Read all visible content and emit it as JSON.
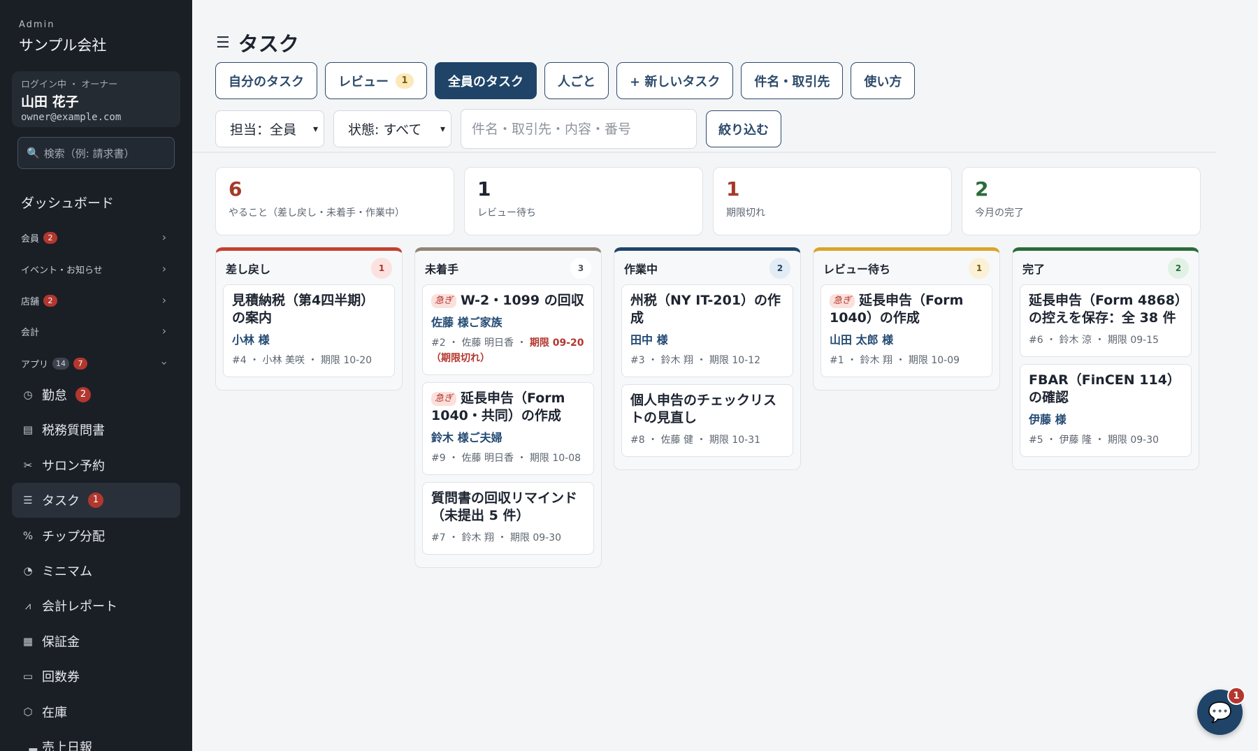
{
  "sidebar": {
    "admin_label": "Admin",
    "company": "サンプル会社",
    "user": {
      "role": "ログイン中 ・ オーナー",
      "name": "山田 花子",
      "email": "owner@example.com"
    },
    "search_placeholder": "検索（例: 請求書）",
    "dashboard": "ダッシュボード",
    "groups": [
      {
        "label": "会員",
        "badge": "2"
      },
      {
        "label": "イベント・お知らせ",
        "badge": ""
      },
      {
        "label": "店舗",
        "badge": "2"
      },
      {
        "label": "会計",
        "badge": ""
      },
      {
        "label": "アプリ",
        "badge_gray": "14",
        "badge": "7"
      }
    ],
    "nav": [
      {
        "label": "勤怠",
        "icon": "clock-icon",
        "badge": "2"
      },
      {
        "label": "税務質問書",
        "icon": "document-icon",
        "badge": ""
      },
      {
        "label": "サロン予約",
        "icon": "scissors-icon",
        "badge": ""
      },
      {
        "label": "タスク",
        "icon": "checklist-icon",
        "badge": "1"
      },
      {
        "label": "チップ分配",
        "icon": "percent-icon",
        "badge": ""
      },
      {
        "label": "ミニマム",
        "icon": "gauge-icon",
        "badge": ""
      },
      {
        "label": "会計レポート",
        "icon": "chart-icon",
        "badge": ""
      },
      {
        "label": "保証金",
        "icon": "receipt-icon",
        "badge": ""
      },
      {
        "label": "回数券",
        "icon": "ticket-icon",
        "badge": ""
      },
      {
        "label": "在庫",
        "icon": "box-icon",
        "badge": ""
      },
      {
        "label": "売上日報",
        "icon": "bar-chart-icon",
        "badge": ""
      }
    ]
  },
  "header": {
    "title": "タスク",
    "icon": "checklist-icon"
  },
  "tabs": [
    {
      "label": "自分のタスク"
    },
    {
      "label": "レビュー",
      "badge": "1"
    },
    {
      "label": "全員のタスク",
      "active": true
    },
    {
      "label": "人ごと"
    },
    {
      "label": "+ 新しいタスク"
    },
    {
      "label": "件名・取引先"
    },
    {
      "label": "使い方"
    }
  ],
  "filters": {
    "assignee": "担当：全員",
    "status": "状態: すべて",
    "search_placeholder": "件名・取引先・内容・番号",
    "submit": "絞り込む"
  },
  "stats": [
    {
      "value": "6",
      "label": "やること（差し戻し・未着手・作業中）",
      "color": "#a53a2a"
    },
    {
      "value": "1",
      "label": "レビュー待ち",
      "color": "#1d2430"
    },
    {
      "value": "1",
      "label": "期限切れ",
      "color": "#a53a2a"
    },
    {
      "value": "2",
      "label": "今月の完了",
      "color": "#2a6b3a"
    }
  ],
  "columns": [
    {
      "title": "差し戻し",
      "count": "1",
      "color": "#c4402f",
      "count_bg": "#fbe2df",
      "count_color": "#a53a2a",
      "cards": [
        {
          "urgent": "",
          "title": "見積納税（第4四半期）の案内",
          "client": "小林 様",
          "meta": "#4 ・ 小林 美咲 ・ 期限 10-20"
        }
      ]
    },
    {
      "title": "未着手",
      "count": "3",
      "color": "#8f8576",
      "count_bg": "#ffffff",
      "count_color": "#4a5260",
      "cards": [
        {
          "urgent": "急ぎ",
          "title": "W-2・1099 の回収",
          "client": "佐藤 様ご家族",
          "meta": "#2 ・ 佐藤 明日香 ・ ",
          "due": "期限 09-20（期限切れ）"
        },
        {
          "urgent": "急ぎ",
          "title": "延長申告（Form 1040・共同）の作成",
          "client": "鈴木 様ご夫婦",
          "meta": "#9 ・ 佐藤 明日香 ・ 期限 10-08"
        },
        {
          "urgent": "",
          "title": "質問書の回収リマインド（未提出 5 件）",
          "client": "",
          "meta": "#7 ・ 鈴木 翔 ・ 期限 09-30"
        }
      ]
    },
    {
      "title": "作業中",
      "count": "2",
      "color": "#1f4468",
      "count_bg": "#e3ebf4",
      "count_color": "#1f4468",
      "cards": [
        {
          "urgent": "",
          "title": "州税（NY IT-201）の作成",
          "client": "田中 様",
          "meta": "#3 ・ 鈴木 翔 ・ 期限 10-12"
        },
        {
          "urgent": "",
          "title": "個人申告のチェックリストの見直し",
          "client": "",
          "meta": "#8 ・ 佐藤 健 ・ 期限 10-31"
        }
      ]
    },
    {
      "title": "レビュー待ち",
      "count": "1",
      "color": "#d9a527",
      "count_bg": "#fbf1d6",
      "count_color": "#7a5a12",
      "cards": [
        {
          "urgent": "急ぎ",
          "title": "延長申告（Form 1040）の作成",
          "client": "山田 太郎 様",
          "meta": "#1 ・ 鈴木 翔 ・ 期限 10-09"
        }
      ]
    },
    {
      "title": "完了",
      "count": "2",
      "color": "#2a6b3a",
      "count_bg": "#e2f1e5",
      "count_color": "#2a6b3a",
      "cards": [
        {
          "urgent": "",
          "title": "延長申告（Form 4868）の控えを保存：全 38 件",
          "client": "",
          "meta": "#6 ・ 鈴木 涼 ・ 期限 09-15"
        },
        {
          "urgent": "",
          "title": "FBAR（FinCEN 114）の確認",
          "client": "伊藤 様",
          "meta": "#5 ・ 伊藤 隆 ・ 期限 09-30"
        }
      ]
    }
  ],
  "chat": {
    "badge": "1",
    "icon": "chat-bubble-icon"
  }
}
